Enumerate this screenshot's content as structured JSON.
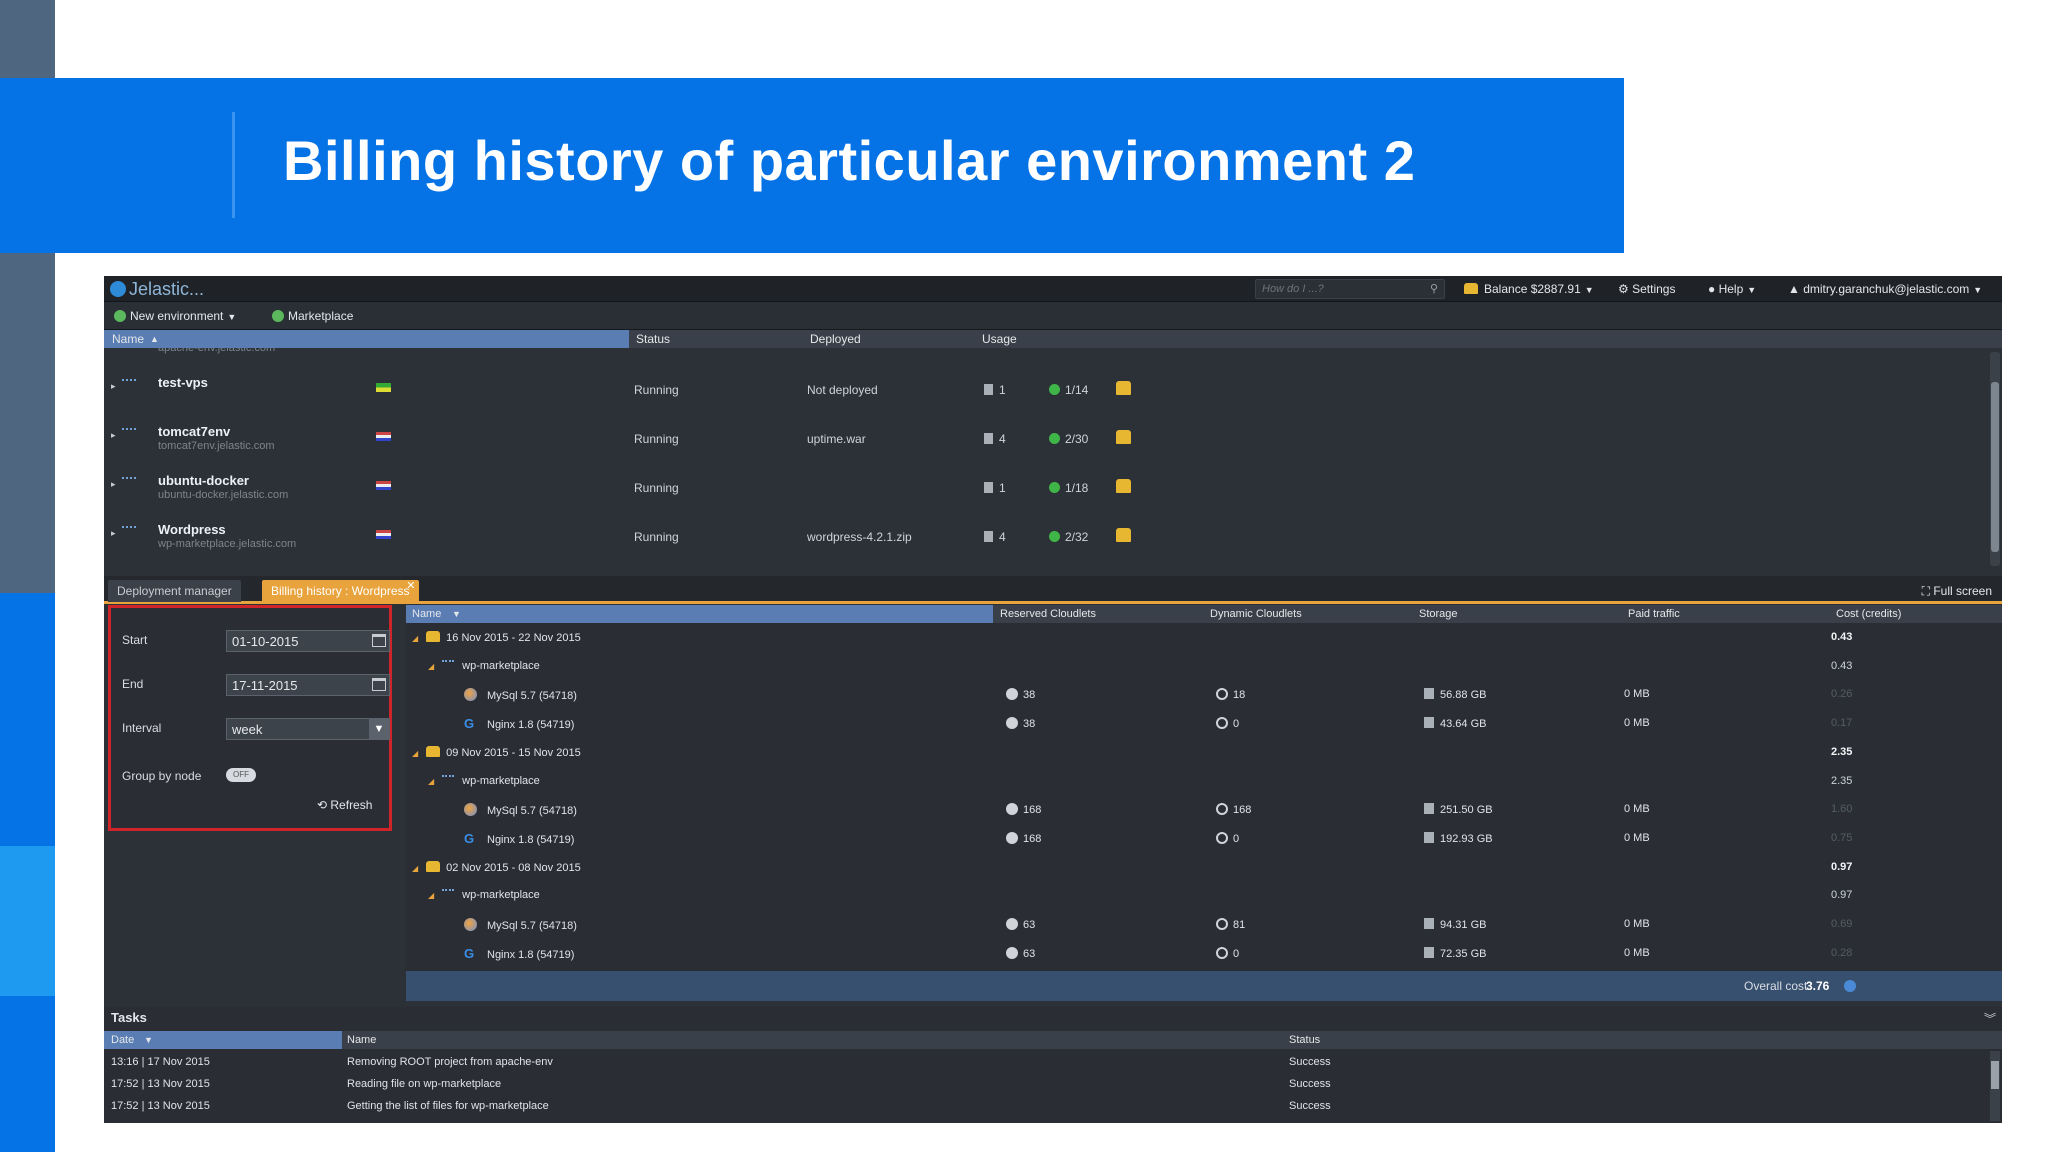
{
  "slide": {
    "title": "Billing history of particular environment 2"
  },
  "app": {
    "logo": "Jelastic...",
    "search_placeholder": "How do I ...?",
    "balance": "Balance $2887.91",
    "settings": "Settings",
    "help": "Help",
    "account": "dmitry.garanchuk@jelastic.com",
    "toolbar": {
      "new_env": "New environment",
      "marketplace": "Marketplace"
    },
    "env_headers": {
      "name": "Name",
      "status": "Status",
      "deployed": "Deployed",
      "usage": "Usage"
    },
    "environments": [
      {
        "name": "",
        "domain": "apache-env.jelastic.com",
        "status": "",
        "deployed": "",
        "nodes": "",
        "cloudlets": "",
        "flag": "us"
      },
      {
        "name": "test-vps",
        "domain": "",
        "status": "Running",
        "deployed": "Not deployed",
        "nodes": "1",
        "cloudlets": "1/14",
        "flag": "br"
      },
      {
        "name": "tomcat7env",
        "domain": "tomcat7env.jelastic.com",
        "status": "Running",
        "deployed": "uptime.war",
        "nodes": "4",
        "cloudlets": "2/30",
        "flag": "us"
      },
      {
        "name": "ubuntu-docker",
        "domain": "ubuntu-docker.jelastic.com",
        "status": "Running",
        "deployed": "",
        "nodes": "1",
        "cloudlets": "1/18",
        "flag": "us"
      },
      {
        "name": "Wordpress",
        "domain": "wp-marketplace.jelastic.com",
        "status": "Running",
        "deployed": "wordpress-4.2.1.zip",
        "nodes": "4",
        "cloudlets": "2/32",
        "flag": "us"
      }
    ],
    "tabs": {
      "deployment": "Deployment manager",
      "billing": "Billing history : Wordpress",
      "fullscreen": "Full screen"
    },
    "filter": {
      "start_label": "Start",
      "start_value": "01-10-2015",
      "end_label": "End",
      "end_value": "17-11-2015",
      "interval_label": "Interval",
      "interval_value": "week",
      "group_label": "Group by node",
      "group_toggle": "OFF",
      "refresh": "Refresh"
    },
    "billing_headers": {
      "name": "Name",
      "reserved": "Reserved Cloudlets",
      "dynamic": "Dynamic Cloudlets",
      "storage": "Storage",
      "traffic": "Paid traffic",
      "cost": "Cost (credits)"
    },
    "billing_rows": [
      {
        "level": 0,
        "name": "16 Nov 2015 - 22 Nov 2015",
        "reserved": "",
        "dynamic": "",
        "storage": "",
        "traffic": "",
        "cost": "0.43"
      },
      {
        "level": 1,
        "name": "wp-marketplace",
        "reserved": "",
        "dynamic": "",
        "storage": "",
        "traffic": "",
        "cost": "0.43"
      },
      {
        "level": 2,
        "kind": "mysql",
        "name": "MySql 5.7 (54718)",
        "reserved": "38",
        "dynamic": "18",
        "storage": "56.88 GB",
        "traffic": "0 MB",
        "cost": "0.26"
      },
      {
        "level": 2,
        "kind": "nginx",
        "name": "Nginx 1.8 (54719)",
        "reserved": "38",
        "dynamic": "0",
        "storage": "43.64 GB",
        "traffic": "0 MB",
        "cost": "0.17"
      },
      {
        "level": 0,
        "name": "09 Nov 2015 - 15 Nov 2015",
        "reserved": "",
        "dynamic": "",
        "storage": "",
        "traffic": "",
        "cost": "2.35"
      },
      {
        "level": 1,
        "name": "wp-marketplace",
        "reserved": "",
        "dynamic": "",
        "storage": "",
        "traffic": "",
        "cost": "2.35"
      },
      {
        "level": 2,
        "kind": "mysql",
        "name": "MySql 5.7 (54718)",
        "reserved": "168",
        "dynamic": "168",
        "storage": "251.50 GB",
        "traffic": "0 MB",
        "cost": "1.60"
      },
      {
        "level": 2,
        "kind": "nginx",
        "name": "Nginx 1.8 (54719)",
        "reserved": "168",
        "dynamic": "0",
        "storage": "192.93 GB",
        "traffic": "0 MB",
        "cost": "0.75"
      },
      {
        "level": 0,
        "name": "02 Nov 2015 - 08 Nov 2015",
        "reserved": "",
        "dynamic": "",
        "storage": "",
        "traffic": "",
        "cost": "0.97"
      },
      {
        "level": 1,
        "name": "wp-marketplace",
        "reserved": "",
        "dynamic": "",
        "storage": "",
        "traffic": "",
        "cost": "0.97"
      },
      {
        "level": 2,
        "kind": "mysql",
        "name": "MySql 5.7 (54718)",
        "reserved": "63",
        "dynamic": "81",
        "storage": "94.31 GB",
        "traffic": "0 MB",
        "cost": "0.69"
      },
      {
        "level": 2,
        "kind": "nginx",
        "name": "Nginx 1.8 (54719)",
        "reserved": "63",
        "dynamic": "0",
        "storage": "72.35 GB",
        "traffic": "0 MB",
        "cost": "0.28"
      }
    ],
    "overall": {
      "label": "Overall cost",
      "value": "3.76"
    },
    "tasks": {
      "title": "Tasks",
      "headers": {
        "date": "Date",
        "name": "Name",
        "status": "Status"
      },
      "rows": [
        {
          "date": "13:16 | 17 Nov 2015",
          "name": "Removing ROOT project from apache-env",
          "status": "Success"
        },
        {
          "date": "17:52 | 13 Nov 2015",
          "name": "Reading file on wp-marketplace",
          "status": "Success"
        },
        {
          "date": "17:52 | 13 Nov 2015",
          "name": "Getting the list of files for wp-marketplace",
          "status": "Success"
        }
      ]
    }
  },
  "colors": {
    "brand_blue": "#0573e5",
    "billing_tab": "#e8a33c",
    "highlight_border": "#d0242b",
    "app_bg": "#2c3138"
  }
}
